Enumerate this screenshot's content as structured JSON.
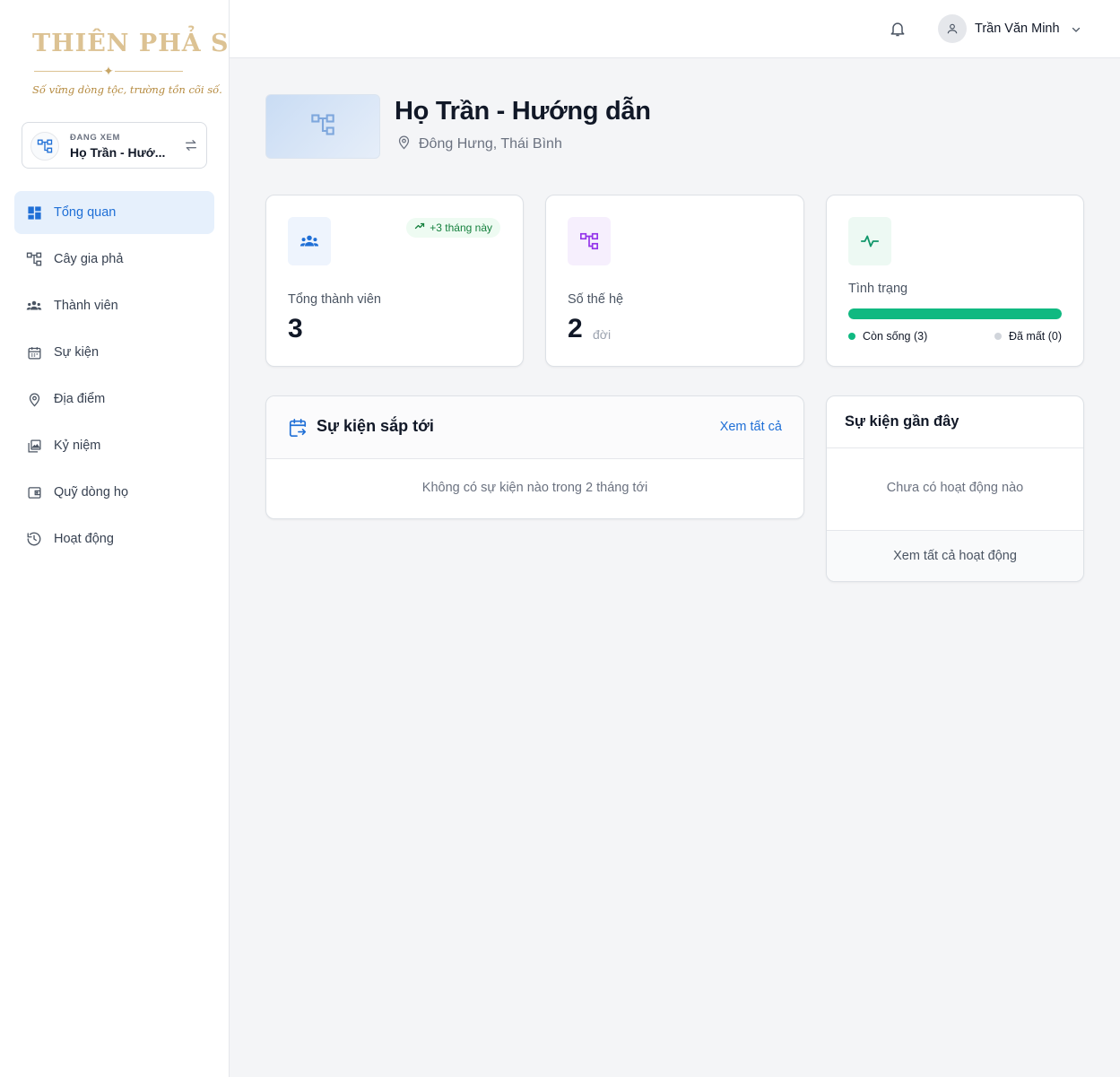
{
  "brand": {
    "logo_text": "THIÊN PHẢ SỐ",
    "slogan": "Số vững dòng tộc, trường tồn cõi số."
  },
  "family_switcher": {
    "caption": "ĐANG XEM",
    "name": "Họ Trần - Hướ...",
    "icon": "family-tree-icon",
    "swap_icon": "swap-arrows-icon"
  },
  "nav": {
    "items": [
      {
        "label": "Tổng quan",
        "icon": "dashboard-icon",
        "active": true
      },
      {
        "label": "Cây gia phả",
        "icon": "tree-icon",
        "active": false
      },
      {
        "label": "Thành viên",
        "icon": "people-icon",
        "active": false
      },
      {
        "label": "Sự kiện",
        "icon": "calendar-icon",
        "active": false
      },
      {
        "label": "Địa điểm",
        "icon": "location-pin-icon",
        "active": false
      },
      {
        "label": "Kỷ niệm",
        "icon": "photo-library-icon",
        "active": false
      },
      {
        "label": "Quỹ dòng họ",
        "icon": "wallet-icon",
        "active": false
      },
      {
        "label": "Hoạt động",
        "icon": "history-icon",
        "active": false
      }
    ]
  },
  "topbar": {
    "user_name": "Trần Văn Minh"
  },
  "family": {
    "title": "Họ Trần - Hướng dẫn",
    "location": "Đông Hưng, Thái Bình"
  },
  "stats": {
    "members": {
      "label": "Tổng thành viên",
      "value": "3",
      "trend": "+3 tháng này"
    },
    "generations": {
      "label": "Số thế hệ",
      "value": "2",
      "unit": "đời"
    },
    "status": {
      "label": "Tình trạng",
      "alive_label": "Còn sống (3)",
      "deceased_label": "Đã mất (0)",
      "alive_fraction": 1.0
    }
  },
  "upcoming_events": {
    "title": "Sự kiện sắp tới",
    "view_all": "Xem tất cả",
    "empty": "Không có sự kiện nào trong 2 tháng tới"
  },
  "recent_events": {
    "title": "Sự kiện gần đây",
    "empty": "Chưa có hoạt động nào",
    "view_all": "Xem tất cả hoạt động"
  },
  "colors": {
    "accent": "#1f6fd6",
    "active_nav_bg": "#e6f0fc",
    "alive": "#10b981",
    "deceased": "#d1d5db",
    "logo_gold": "#dcc293",
    "generations_purple": "#9333ea"
  }
}
